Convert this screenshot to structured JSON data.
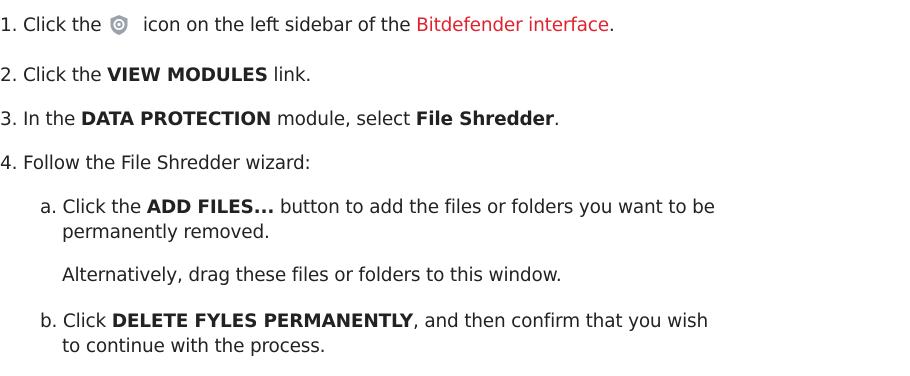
{
  "colors": {
    "accent": "#e0232f",
    "text": "#222222",
    "icon": "#9aa3ad"
  },
  "steps": [
    {
      "num": "1.",
      "pre": "Click the",
      "icon": "shield-icon",
      "mid": "icon on the left sidebar of the",
      "link": "Bitdefender interface",
      "post": "."
    },
    {
      "num": "2.",
      "pre": "Click the",
      "bold": "VIEW MODULES",
      "post": "link."
    },
    {
      "num": "3.",
      "pre": "In the",
      "bold": "DATA PROTECTION",
      "mid": "module, select",
      "bold2": "File Shredder",
      "post": "."
    },
    {
      "num": "4.",
      "text": "Follow the File Shredder wizard:"
    }
  ],
  "substeps": [
    {
      "letter": "a.",
      "pre": "Click the",
      "bold": "ADD FILES...",
      "post": "button to add the files or folders you want to be",
      "cont": "permanently removed.",
      "note": "Alternatively, drag these files or folders to this window."
    },
    {
      "letter": "b.",
      "pre": "Click",
      "bold": "DELETE FYLES PERMANENTLY",
      "post": ", and then confirm that you wish",
      "cont": "to continue with the process."
    }
  ]
}
